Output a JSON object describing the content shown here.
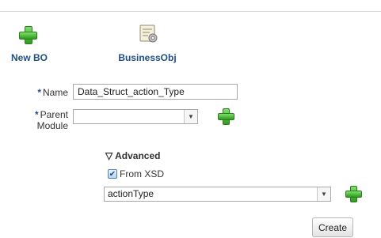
{
  "toolbar": {
    "new_bo_label": "New BO",
    "business_obj_label": "BusinessObj"
  },
  "form": {
    "required_marker": "*",
    "name_label": "Name",
    "name_value": "Data_Struct_action_Type",
    "parent_module_label_line1": "Parent",
    "parent_module_label_line2": "Module",
    "parent_module_value": ""
  },
  "advanced": {
    "toggle_glyph": "▽",
    "label": "Advanced",
    "from_xsd_label": "From XSD",
    "from_xsd_checked": true,
    "xsd_type_value": "actionType"
  },
  "actions": {
    "create_label": "Create"
  },
  "icons": [
    "add-plus-icon",
    "business-object-icon",
    "chevron-down-icon",
    "checkbox-check-icon",
    "collapse-triangle-icon"
  ],
  "colors": {
    "accent": "#1f4e86",
    "plus_green": "#2e9a1f"
  }
}
